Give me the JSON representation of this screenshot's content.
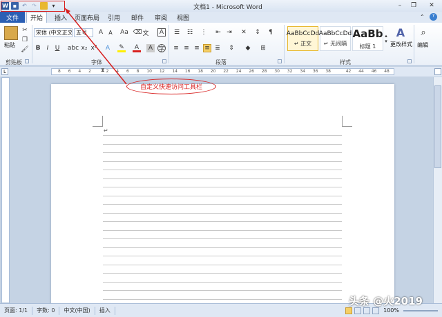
{
  "title_bar": {
    "title": "文档1 - Microsoft Word"
  },
  "qat": {
    "word_icon": "word-logo-icon",
    "save_icon": "save-icon",
    "undo_icon": "undo-icon",
    "redo_icon": "redo-icon",
    "open_icon": "open-folder-icon",
    "customize_icon": "dropdown-arrow-icon"
  },
  "tabs": {
    "file": "文件",
    "home": "开始",
    "insert": "插入",
    "layout": "页面布局",
    "references": "引用",
    "mailings": "邮件",
    "review": "审阅",
    "view": "视图"
  },
  "ribbon": {
    "clipboard": {
      "paste": "粘贴",
      "label": "剪贴板"
    },
    "font": {
      "font_name": "宋体 (中文正文",
      "font_size": "五号",
      "label": "字体"
    },
    "paragraph": {
      "label": "段落"
    },
    "styles": {
      "items": [
        {
          "sample": "AaBbCcDd",
          "name": "↵ 正文"
        },
        {
          "sample": "AaBbCcDd",
          "name": "↵ 无间隔"
        },
        {
          "sample": "AaBb",
          "name": "标题 1"
        }
      ],
      "change_styles": "更改样式",
      "label": "样式"
    },
    "editing": {
      "label": "编辑"
    }
  },
  "ruler": {
    "ticks": [
      "8",
      "6",
      "4",
      "2",
      "",
      "2",
      "4",
      "6",
      "8",
      "10",
      "12",
      "14",
      "16",
      "18",
      "20",
      "22",
      "24",
      "26",
      "28",
      "30",
      "32",
      "34",
      "36",
      "38",
      "",
      "42",
      "44",
      "46",
      "48"
    ]
  },
  "callout": {
    "text": "自定义快速访问工具栏"
  },
  "document": {
    "paragraph_mark": "↵"
  },
  "status_bar": {
    "page": "页面: 1/1",
    "words": "字数: 0",
    "language": "中文(中国)",
    "insert_mode": "插入",
    "zoom": "100%"
  },
  "watermark": {
    "text": "头条 @火2019"
  },
  "colors": {
    "accent": "#2b579a",
    "annotation_red": "#d8201f",
    "file_tab": "#2b5fb4"
  }
}
